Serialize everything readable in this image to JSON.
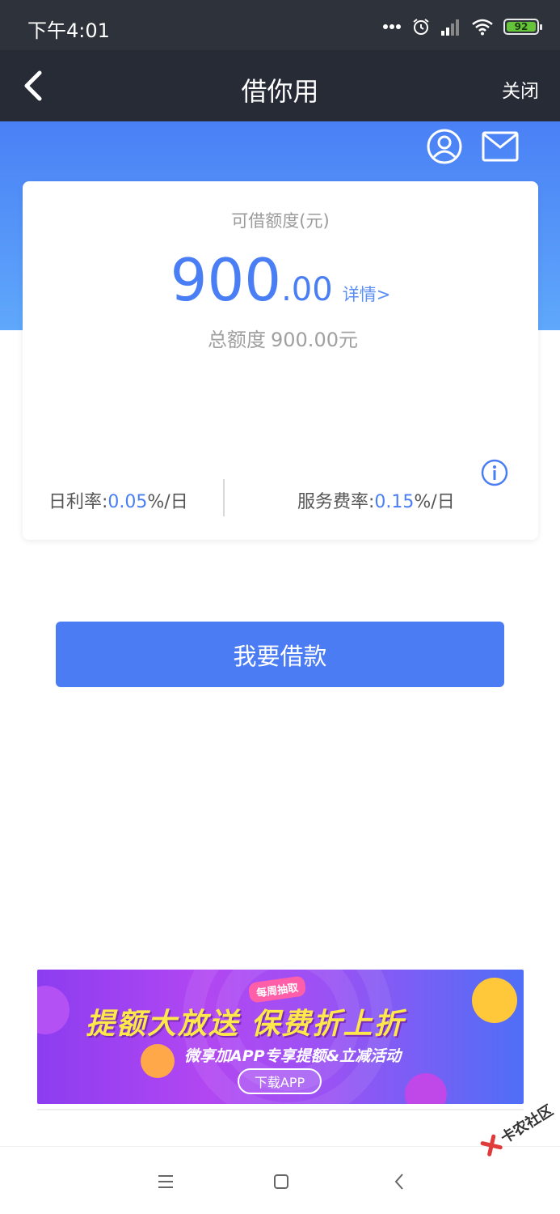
{
  "status_bar": {
    "time": "下午4:01",
    "battery_level": "92",
    "icons": [
      "more-dots-icon",
      "alarm-icon",
      "signal-icon",
      "wifi-icon",
      "battery-icon"
    ]
  },
  "nav": {
    "title": "借你用",
    "close_label": "关闭",
    "back_icon": "chevron-left-icon"
  },
  "header_icons": [
    "user-profile-icon",
    "mail-icon"
  ],
  "credit_card": {
    "label": "可借额度(元)",
    "amount_integer": "900",
    "amount_decimal": ".00",
    "detail_link": "详情>",
    "total_label": "总额度",
    "total_value": "900.00元",
    "daily_rate_label": "日利率:",
    "daily_rate_value": "0.05",
    "daily_rate_unit": "%/日",
    "service_rate_label": "服务费率:",
    "service_rate_value": "0.15",
    "service_rate_unit": "%/日"
  },
  "borrow_button": "我要借款",
  "banner": {
    "tag": "每周抽取",
    "headline": "提额大放送  保费折上折",
    "subline": "微享加APP专享提额&立减活动",
    "button": "下载APP"
  },
  "watermark": "卡农社区",
  "colors": {
    "accent": "#4b7cf3",
    "nav_bg": "#262b36",
    "status_bg": "#2e323a",
    "banner_yellow": "#ffe94a"
  }
}
